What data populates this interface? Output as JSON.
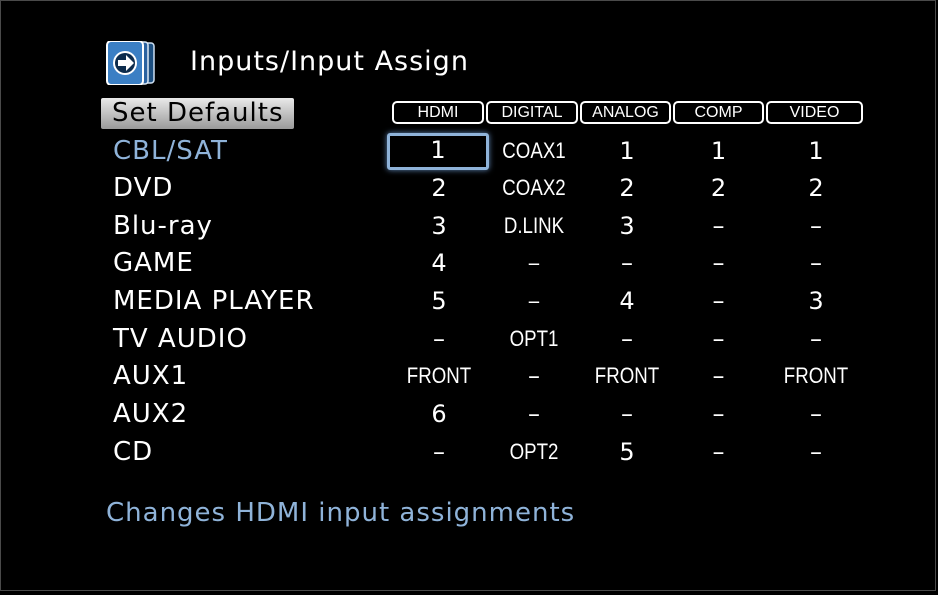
{
  "title": "Inputs/Input Assign",
  "set_defaults_label": "Set Defaults",
  "columns": [
    "HDMI",
    "DIGITAL",
    "ANALOG",
    "COMP",
    "VIDEO"
  ],
  "rows": [
    {
      "label": "CBL/SAT",
      "cells": [
        "1",
        "COAX1",
        "1",
        "1",
        "1"
      ]
    },
    {
      "label": "DVD",
      "cells": [
        "2",
        "COAX2",
        "2",
        "2",
        "2"
      ]
    },
    {
      "label": "Blu-ray",
      "cells": [
        "3",
        "D.LINK",
        "3",
        "–",
        "–"
      ]
    },
    {
      "label": "GAME",
      "cells": [
        "4",
        "–",
        "–",
        "–",
        "–"
      ]
    },
    {
      "label": "MEDIA PLAYER",
      "cells": [
        "5",
        "–",
        "4",
        "–",
        "3"
      ]
    },
    {
      "label": "TV AUDIO",
      "cells": [
        "–",
        "OPT1",
        "–",
        "–",
        "–"
      ]
    },
    {
      "label": "AUX1",
      "cells": [
        "FRONT",
        "–",
        "FRONT",
        "–",
        "FRONT"
      ]
    },
    {
      "label": "AUX2",
      "cells": [
        "6",
        "–",
        "–",
        "–",
        "–"
      ]
    },
    {
      "label": "CD",
      "cells": [
        "–",
        "OPT2",
        "5",
        "–",
        "–"
      ]
    }
  ],
  "status_text": "Changes HDMI input assignments",
  "colors": {
    "accent": "#8fb3d9",
    "background": "#000000",
    "icon_blue": "#2f6ea8"
  },
  "header_icon": "input-arrow-icon"
}
